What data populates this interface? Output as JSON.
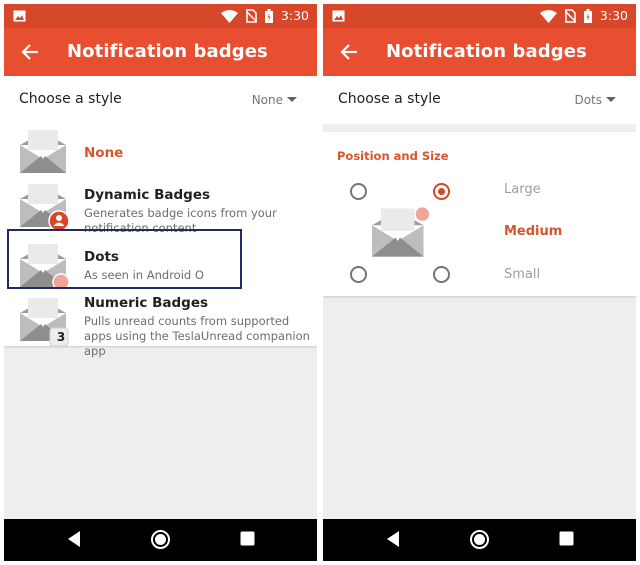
{
  "colors": {
    "primary_dark": "#d7472a",
    "primary": "#e84e30",
    "accent": "#d7542e",
    "highlight_box": "#1f2a6b",
    "dot_badge": "#f0a598"
  },
  "status_bar": {
    "time": "3:30",
    "icons": [
      "gallery-icon",
      "wifi-icon",
      "no-sim-icon",
      "battery-icon"
    ]
  },
  "left_screen": {
    "app_bar": {
      "title": "Notification badges",
      "back_icon": "arrow-back-icon"
    },
    "style_row": {
      "label": "Choose a style",
      "value": "None"
    },
    "items": [
      {
        "title": "None",
        "subtitle": "",
        "icon": "envelope-icon",
        "selected": true
      },
      {
        "title": "Dynamic Badges",
        "subtitle": "Generates badge icons from your notification content",
        "icon": "envelope-person-badge-icon"
      },
      {
        "title": "Dots",
        "subtitle": "As seen in Android O",
        "icon": "envelope-dot-badge-icon",
        "highlighted": true
      },
      {
        "title": "Numeric Badges",
        "subtitle": "Pulls unread counts from supported apps using the TeslaUnread companion app",
        "icon": "envelope-number-badge-icon",
        "badge_number": "3"
      }
    ]
  },
  "right_screen": {
    "app_bar": {
      "title": "Notification badges",
      "back_icon": "arrow-back-icon"
    },
    "style_row": {
      "label": "Choose a style",
      "value": "Dots"
    },
    "settings": {
      "section_title": "Position and Size",
      "sizes": [
        {
          "label": "Large",
          "selected": false
        },
        {
          "label": "Medium",
          "selected": true
        },
        {
          "label": "Small",
          "selected": false
        }
      ],
      "position_selected": "top-right"
    }
  },
  "nav_bar": {
    "buttons": [
      "back-nav-icon",
      "home-nav-icon",
      "recents-nav-icon"
    ]
  }
}
